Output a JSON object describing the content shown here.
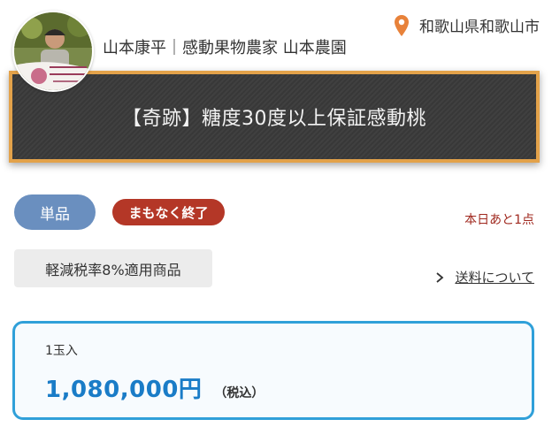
{
  "header": {
    "location": "和歌山県和歌山市",
    "farmer": "山本康平｜感動果物農家 山本農園"
  },
  "product": {
    "title": "【奇跡】糖度30度以上保証感動桃"
  },
  "badges": {
    "single": "単品",
    "ending_soon": "まもなく終了",
    "remaining": "本日あと1点"
  },
  "tax_label": "軽減税率8%適用商品",
  "shipping_link": "送料について",
  "price_box": {
    "variant": "1玉入",
    "price": "1,080,000円",
    "tax_note": "（税込）"
  },
  "colors": {
    "accent_blue": "#1a7cc7",
    "badge_blue": "#6a8fbf",
    "badge_red": "#b43727",
    "banner_border": "#e3a24a",
    "pin": "#e8823a"
  },
  "icons": [
    "location-pin-icon",
    "chevron-right-icon"
  ]
}
